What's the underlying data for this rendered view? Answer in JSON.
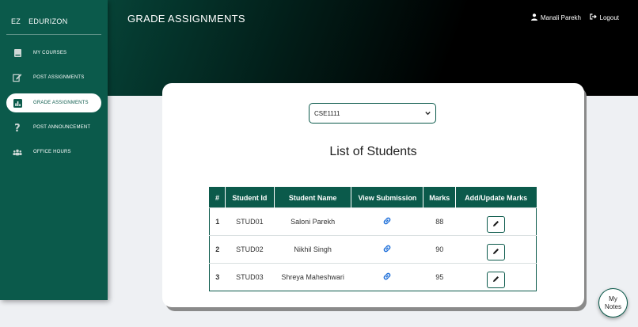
{
  "brand": {
    "short": "EZ",
    "name": "EDURIZON"
  },
  "header": {
    "title": "GRADE ASSIGNMENTS",
    "user": "Manali Parekh",
    "logout": "Logout"
  },
  "sidebar": {
    "items": [
      {
        "label": "MY COURSES",
        "icon": "book-icon",
        "active": false
      },
      {
        "label": "POST ASSIGNMENTS",
        "icon": "edit-icon",
        "active": false
      },
      {
        "label": "GRADE ASSIGNMENTS",
        "icon": "chart-icon",
        "active": true
      },
      {
        "label": "POST ANNOUNCEMENT",
        "icon": "question-icon",
        "active": false
      },
      {
        "label": "OFFICE HOURS",
        "icon": "group-icon",
        "active": false
      }
    ]
  },
  "main": {
    "course_select": {
      "value": "CSE1111"
    },
    "list_title": "List of Students",
    "table": {
      "headers": [
        "#",
        "Student Id",
        "Student Name",
        "View Submission",
        "Marks",
        "Add/Update Marks"
      ],
      "rows": [
        {
          "num": "1",
          "id": "STUD01",
          "name": "Saloni Parekh",
          "marks": "88"
        },
        {
          "num": "2",
          "id": "STUD02",
          "name": "Nikhil Singh",
          "marks": "90"
        },
        {
          "num": "3",
          "id": "STUD03",
          "name": "Shreya Maheshwari",
          "marks": "95"
        }
      ]
    }
  },
  "notes_button": {
    "line1": "My",
    "line2": "Notes"
  },
  "colors": {
    "primary": "#0b5a4b",
    "link": "#1e6fd9",
    "background": "#eef0f3"
  }
}
